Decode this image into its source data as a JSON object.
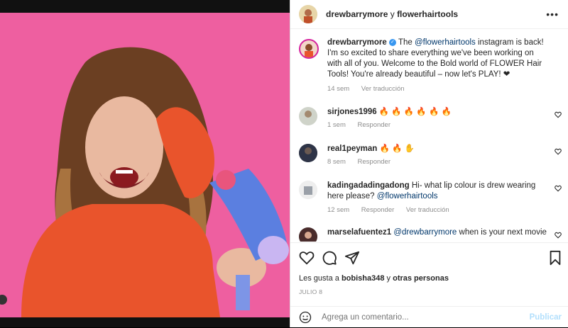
{
  "header": {
    "user1": "drewbarrymore",
    "joiner": "y",
    "user2": "flowerhairtools",
    "more": "•••"
  },
  "caption": {
    "username": "drewbarrymore",
    "text_pre": "The",
    "mention": "@flowerhairtools",
    "text_post": "instagram is back! I'm so excited to share everything we've been working on with all of you. Welcome to the Bold world of FLOWER Hair Tools! You're already beautiful – now let's PLAY! ❤",
    "age": "14 sem",
    "translate": "Ver traducción"
  },
  "comments": [
    {
      "username": "sirjones1996",
      "text": "🔥 🔥 🔥 🔥 🔥 🔥",
      "age": "1 sem",
      "reply": "Responder"
    },
    {
      "username": "real1peyman",
      "text": "🔥 🔥 ✋",
      "age": "8 sem",
      "reply": "Responder"
    },
    {
      "username": "kadingadadingadong",
      "text_pre": "Hi- what lip colour is drew wearing here please?",
      "mention": "@flowerhairtools",
      "age": "12 sem",
      "reply": "Responder",
      "translate": "Ver traducción"
    },
    {
      "username": "marselafuentez1",
      "mention": "@drewbarrymore",
      "text": "when is your next movie"
    }
  ],
  "likes": {
    "prefix": "Les gusta a",
    "user": "bobisha348",
    "mid": "y",
    "others": "otras personas"
  },
  "date": "JULIO 8",
  "add_comment": {
    "placeholder": "Agrega un comentario...",
    "post": "Publicar"
  }
}
